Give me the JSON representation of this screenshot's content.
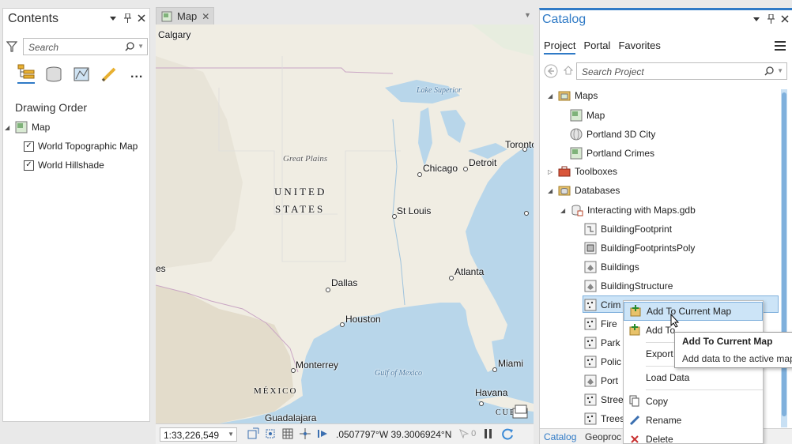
{
  "contents_pane": {
    "title": "Contents",
    "search_placeholder": "Search",
    "section_title": "Drawing Order",
    "map_label": "Map",
    "layers": [
      {
        "label": "World Topographic Map",
        "checked": true
      },
      {
        "label": "World Hillshade",
        "checked": true
      }
    ],
    "more_label": "..."
  },
  "map_view": {
    "tab_label": "Map",
    "labels": {
      "calgary": "Calgary",
      "lake_superior": "Lake Superior",
      "great_plains": "Great Plains",
      "united": "UNITED",
      "states": "STATES",
      "chicago": "Chicago",
      "detroit": "Detroit",
      "toronto": "Toronto",
      "st_louis": "St Louis",
      "es": "es",
      "dallas": "Dallas",
      "atlanta": "Atlanta",
      "houston": "Houston",
      "monterrey": "Monterrey",
      "gulf": "Gulf of Mexico",
      "miami": "Miami",
      "mexico": "MÉXICO",
      "havana": "Havana",
      "guadalajara": "Guadalajara",
      "cuba": "CUB"
    }
  },
  "status_bar": {
    "scale": "1:33,226,549",
    "coordinates": ".0507797°W 39.3006924°N",
    "selection_count": "0"
  },
  "catalog_pane": {
    "title": "Catalog",
    "tabs": [
      "Project",
      "Portal",
      "Favorites"
    ],
    "search_placeholder": "Search Project",
    "tree": {
      "maps": "Maps",
      "map": "Map",
      "portland_3d": "Portland 3D City",
      "portland_crimes": "Portland Crimes",
      "toolboxes": "Toolboxes",
      "databases": "Databases",
      "gdb": "Interacting with Maps.gdb",
      "items": [
        "BuildingFootprint",
        "BuildingFootprintsPoly",
        "Buildings",
        "BuildingStructure",
        "Crim",
        "Fire",
        "Park",
        "Polic",
        "Port",
        "Stree",
        "Trees"
      ]
    },
    "bottom_tabs": [
      "Catalog",
      "Geoproc"
    ]
  },
  "context_menu": {
    "items": [
      "Add To Current Map",
      "Add To",
      "Export",
      "Load Data",
      "Copy",
      "Rename",
      "Delete"
    ]
  },
  "tooltip": {
    "title": "Add To Current Map",
    "description": "Add data to the active map"
  },
  "colors": {
    "accent": "#2f7ac6",
    "selection": "#cce4f7",
    "water": "#b8d6ea",
    "land": "#f0ede3"
  }
}
